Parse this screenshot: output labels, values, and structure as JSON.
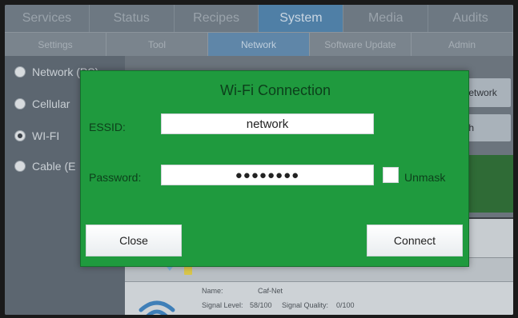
{
  "top_tabs": [
    "Services",
    "Status",
    "Recipes",
    "System",
    "Media",
    "Audits"
  ],
  "active_top_tab_index": 3,
  "sub_tabs": [
    "Settings",
    "Tool",
    "Network",
    "Software Update",
    "Admin"
  ],
  "active_sub_tab_index": 2,
  "connection_types": [
    {
      "label": "Network (PS)",
      "checked": false
    },
    {
      "label": "Cellular",
      "checked": false
    },
    {
      "label": "WI-FI",
      "checked": true
    },
    {
      "label": "Cable (E",
      "checked": false
    }
  ],
  "background_buttons": {
    "add_network": "Add network",
    "search": "Search"
  },
  "network_list": {
    "name_label": "Name:",
    "name_value": "Caf-Net",
    "signal_label": "Signal Level:",
    "signal_value": "58/100",
    "quality_label": "Signal Quality:",
    "quality_value": "0/100"
  },
  "modal": {
    "title": "Wi-Fi Connection",
    "essid_label": "ESSID:",
    "essid_value": "network",
    "password_label": "Password:",
    "password_value": "●●●●●●●●",
    "unmask_label": "Unmask",
    "close_label": "Close",
    "connect_label": "Connect"
  },
  "colors": {
    "modal_green": "#1f9a3e",
    "active_tab": "#4f7fa6",
    "background": "#5a646e"
  }
}
